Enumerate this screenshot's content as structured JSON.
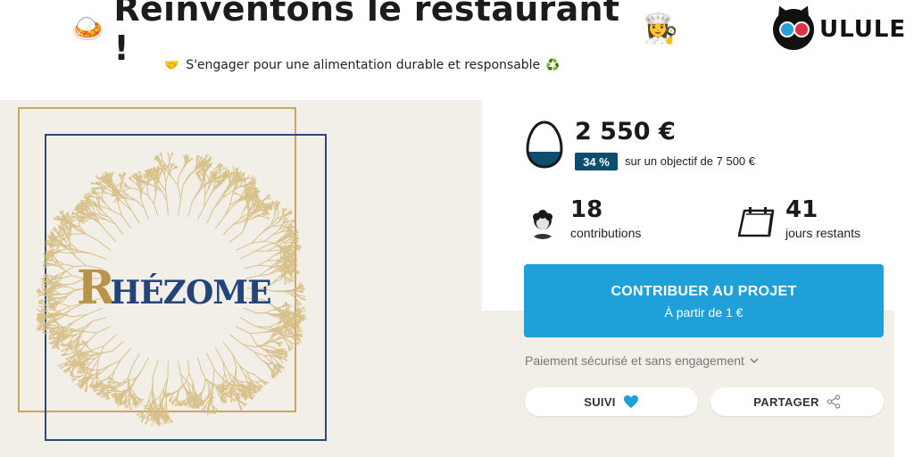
{
  "header": {
    "title_emoji": "🍛",
    "title": "Réinventons le restaurant !",
    "title_emoji_end": "👩‍🍳",
    "subtitle_emoji": "🤝",
    "subtitle": "S'engager pour une alimentation durable et responsable",
    "subtitle_emoji_end": "♻️",
    "brand": "ULULE"
  },
  "cover": {
    "logo_initial": "R",
    "logo_rest": "HÉZOME"
  },
  "campaign": {
    "amount": "2 550 €",
    "percent": "34 %",
    "progress_fraction": 0.34,
    "objective": "sur un objectif de 7 500 €",
    "contributions_count": "18",
    "contributions_label": "contributions",
    "days_count": "41",
    "days_label": "jours restants"
  },
  "cta": {
    "label": "CONTRIBUER AU PROJET",
    "sublabel": "À partir de 1 €"
  },
  "secure_text": "Paiement sécurisé et sans engagement",
  "actions": {
    "follow_label": "SUIVI",
    "share_label": "PARTAGER"
  },
  "colors": {
    "accent": "#1fa0d8",
    "badge": "#0b4f6c",
    "gold": "#c8a85e",
    "navy": "#23447a",
    "beige": "#f2eee8"
  }
}
